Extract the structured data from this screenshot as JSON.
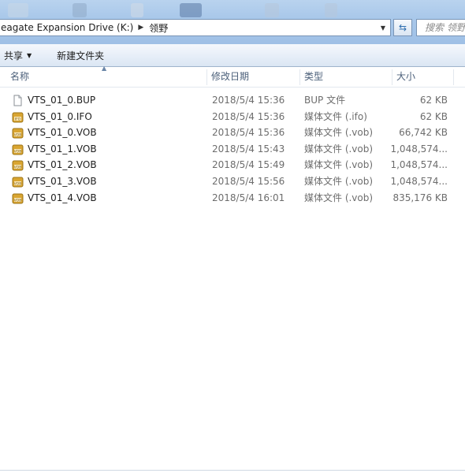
{
  "address_bar": {
    "crumbs": [
      "eagate Expansion Drive (K:)",
      "领野"
    ],
    "search_placeholder": "搜索 领野"
  },
  "toolbar": {
    "share_label": "共享",
    "new_folder_label": "新建文件夹"
  },
  "columns": {
    "name": "名称",
    "date": "修改日期",
    "type": "类型",
    "size": "大小"
  },
  "files": [
    {
      "name": "VTS_01_0.BUP",
      "date": "2018/5/4 15:36",
      "type": "BUP 文件",
      "size": "62 KB",
      "icon": "blank-file-icon"
    },
    {
      "name": "VTS_01_0.IFO",
      "date": "2018/5/4 15:36",
      "type": "媒体文件 (.ifo)",
      "size": "62 KB",
      "icon": "ifo-media-icon"
    },
    {
      "name": "VTS_01_0.VOB",
      "date": "2018/5/4 15:36",
      "type": "媒体文件 (.vob)",
      "size": "66,742 KB",
      "icon": "vob-media-icon"
    },
    {
      "name": "VTS_01_1.VOB",
      "date": "2018/5/4 15:43",
      "type": "媒体文件 (.vob)",
      "size": "1,048,574...",
      "icon": "vob-media-icon"
    },
    {
      "name": "VTS_01_2.VOB",
      "date": "2018/5/4 15:49",
      "type": "媒体文件 (.vob)",
      "size": "1,048,574...",
      "icon": "vob-media-icon"
    },
    {
      "name": "VTS_01_3.VOB",
      "date": "2018/5/4 15:56",
      "type": "媒体文件 (.vob)",
      "size": "1,048,574...",
      "icon": "vob-media-icon"
    },
    {
      "name": "VTS_01_4.VOB",
      "date": "2018/5/4 16:01",
      "type": "媒体文件 (.vob)",
      "size": "835,176 KB",
      "icon": "vob-media-icon"
    }
  ],
  "colors": {
    "titlebar": "#a9c8ea",
    "header_text": "#4c607a",
    "media_icon": "#d9a531"
  }
}
